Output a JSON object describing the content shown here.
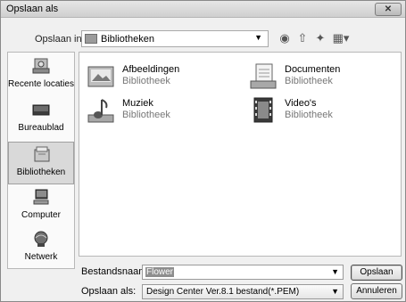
{
  "window": {
    "title": "Opslaan als",
    "close_label": "✕"
  },
  "lookin": {
    "label": "Opslaan in:",
    "value": "Bibliotheken"
  },
  "toolbar": {
    "back": "◉",
    "up": "⇧",
    "new_folder": "✦",
    "view": "▦▾"
  },
  "places": [
    {
      "label": "Recente locaties",
      "icon": "recent-locations-icon"
    },
    {
      "label": "Bureaublad",
      "icon": "desktop-icon"
    },
    {
      "label": "Bibliotheken",
      "icon": "libraries-icon"
    },
    {
      "label": "Computer",
      "icon": "computer-icon"
    },
    {
      "label": "Netwerk",
      "icon": "network-icon"
    }
  ],
  "files": [
    {
      "name": "Afbeeldingen",
      "type": "Bibliotheek",
      "icon": "pictures-library-icon"
    },
    {
      "name": "Documenten",
      "type": "Bibliotheek",
      "icon": "documents-library-icon"
    },
    {
      "name": "Muziek",
      "type": "Bibliotheek",
      "icon": "music-library-icon"
    },
    {
      "name": "Video's",
      "type": "Bibliotheek",
      "icon": "videos-library-icon"
    }
  ],
  "form": {
    "filename_label": "Bestandsnaam:",
    "filename_value": "Flower",
    "filetype_label": "Opslaan als:",
    "filetype_value": "Design Center Ver.8.1 bestand(*.PEM)",
    "save_label": "Opslaan",
    "cancel_label": "Annuleren"
  }
}
